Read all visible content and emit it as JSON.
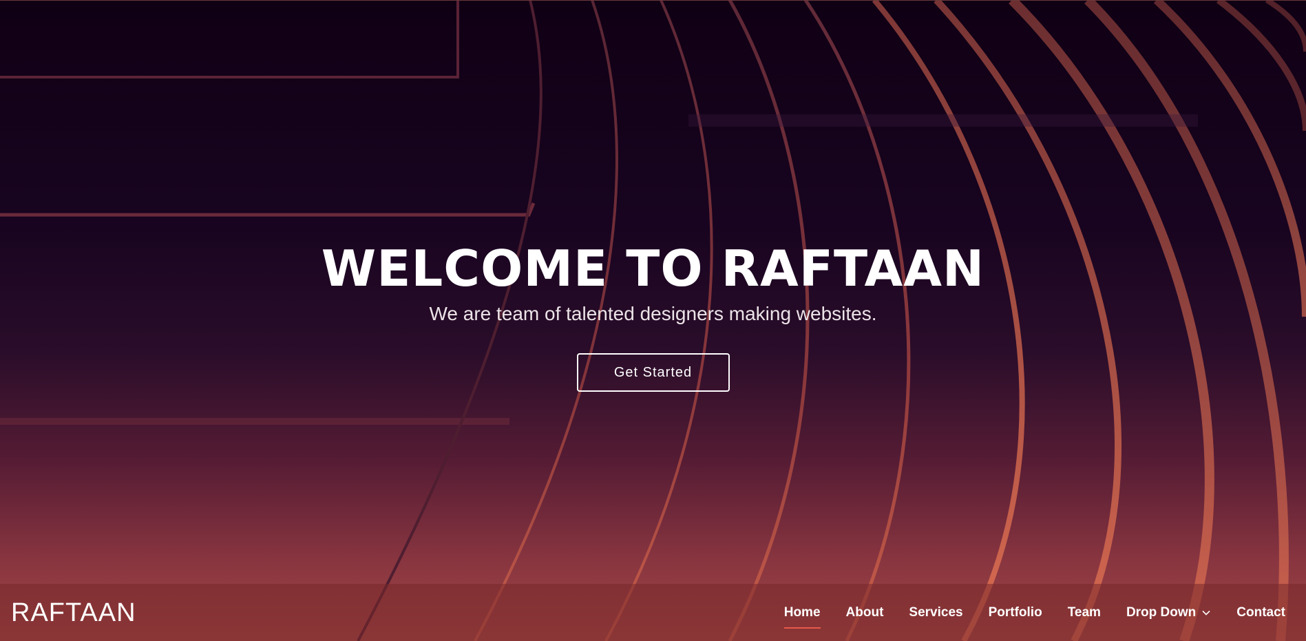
{
  "brand": "RAFTAAN",
  "hero": {
    "title": "WELCOME TO RAFTAAN",
    "subtitle": "We are team of talented designers making websites.",
    "cta_label": "Get Started"
  },
  "nav": {
    "items": [
      {
        "label": "Home",
        "active": true
      },
      {
        "label": "About"
      },
      {
        "label": "Services"
      },
      {
        "label": "Portfolio"
      },
      {
        "label": "Team"
      },
      {
        "label": "Drop Down",
        "icon": "chevron-down-icon"
      },
      {
        "label": "Contact"
      }
    ]
  },
  "colors": {
    "accent": "#e7584b",
    "text": "#ffffff",
    "background_top": "#100014",
    "background_bottom": "#a14845"
  }
}
